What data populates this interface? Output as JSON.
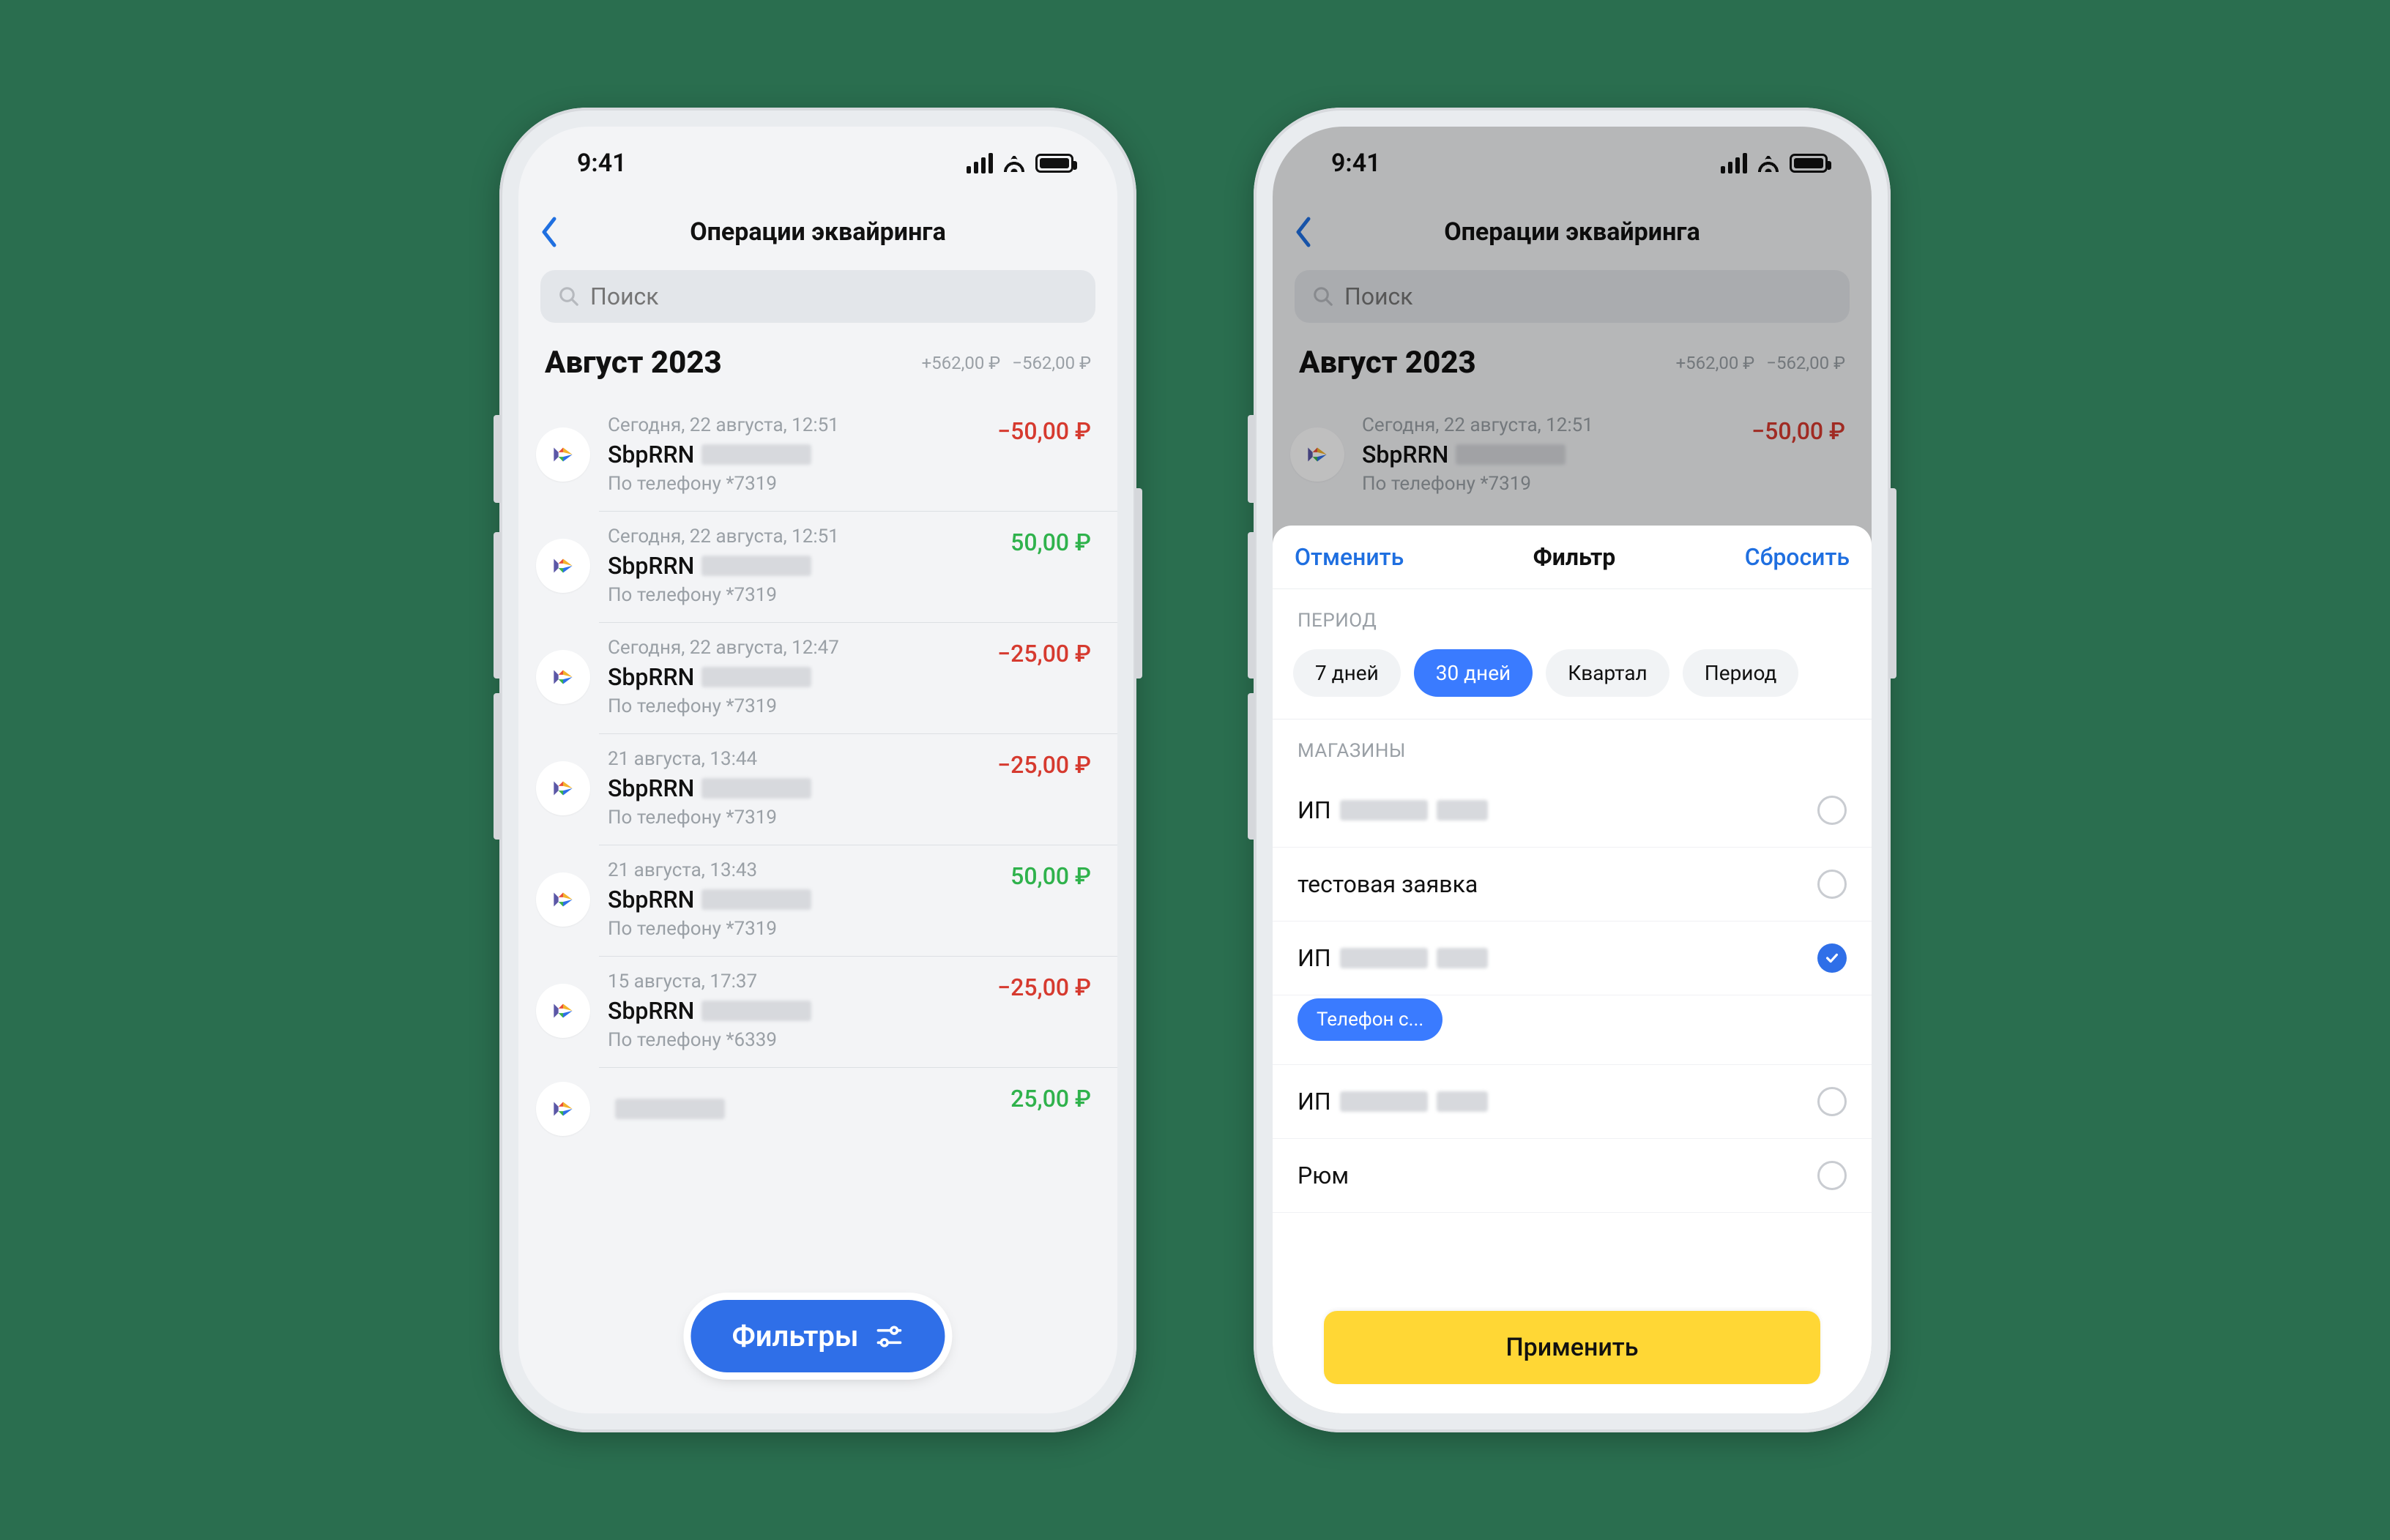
{
  "status": {
    "time": "9:41"
  },
  "nav": {
    "title": "Операции эквайринга"
  },
  "search": {
    "placeholder": "Поиск"
  },
  "month": {
    "label": "Август 2023",
    "plus": "+562,00 ₽",
    "minus": "−562,00 ₽"
  },
  "rows": [
    {
      "time": "Сегодня, 22 августа, 12:51",
      "title": "SbpRRN",
      "sub": "По телефону *7319",
      "amount": "−50,00 ₽",
      "sign": "neg"
    },
    {
      "time": "Сегодня, 22 августа, 12:51",
      "title": "SbpRRN",
      "sub": "По телефону *7319",
      "amount": "50,00 ₽",
      "sign": "pos"
    },
    {
      "time": "Сегодня, 22 августа, 12:47",
      "title": "SbpRRN",
      "sub": "По телефону *7319",
      "amount": "−25,00 ₽",
      "sign": "neg"
    },
    {
      "time": "21 августа, 13:44",
      "title": "SbpRRN",
      "sub": "По телефону *7319",
      "amount": "−25,00 ₽",
      "sign": "neg"
    },
    {
      "time": "21 августа, 13:43",
      "title": "SbpRRN",
      "sub": "По телефону *7319",
      "amount": "50,00 ₽",
      "sign": "pos"
    },
    {
      "time": "15 августа, 17:37",
      "title": "SbpRRN",
      "sub": "По телефону *6339",
      "amount": "−25,00 ₽",
      "sign": "neg"
    },
    {
      "time": "",
      "title": "",
      "sub": "",
      "amount": "25,00 ₽",
      "sign": "pos"
    }
  ],
  "fab": {
    "label": "Фильтры"
  },
  "filter": {
    "cancel": "Отменить",
    "title": "Фильтр",
    "reset": "Сбросить",
    "period_label": "ПЕРИОД",
    "period_opts": [
      "7 дней",
      "30 дней",
      "Квартал",
      "Период"
    ],
    "period_selected": 1,
    "shops_label": "МАГАЗИНЫ",
    "shops": [
      {
        "name": "ИП",
        "redact": true,
        "checked": false
      },
      {
        "name": "тестовая заявка",
        "redact": false,
        "checked": false
      },
      {
        "name": "ИП",
        "redact": true,
        "checked": true,
        "chip": "Телефон с..."
      },
      {
        "name": "ИП",
        "redact": true,
        "checked": false
      },
      {
        "name": "Рюм",
        "redact": false,
        "checked": false
      }
    ],
    "apply": "Применить"
  }
}
